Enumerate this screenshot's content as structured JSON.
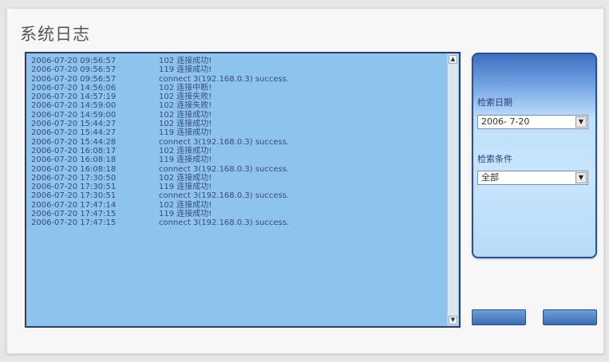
{
  "window": {
    "title": "系统日志"
  },
  "log": {
    "entries": [
      {
        "timestamp": "2006-07-20  09:56:57",
        "message": "102 连接成功!"
      },
      {
        "timestamp": "2006-07-20  09:56:57",
        "message": "119 连接成功!"
      },
      {
        "timestamp": "2006-07-20  09:56:57",
        "message": "connect 3(192.168.0.3) success."
      },
      {
        "timestamp": "2006-07-20  14:56:06",
        "message": "102 连接中断!"
      },
      {
        "timestamp": "2006-07-20  14:57:19",
        "message": "102 连接失败!"
      },
      {
        "timestamp": "2006-07-20  14:59:00",
        "message": "102 连接失败!"
      },
      {
        "timestamp": "2006-07-20  14:59:00",
        "message": "102 连接成功!"
      },
      {
        "timestamp": "2006-07-20  15:44:27",
        "message": "102 连接成功!"
      },
      {
        "timestamp": "2006-07-20  15:44:27",
        "message": "119 连接成功!"
      },
      {
        "timestamp": "2006-07-20  15:44:28",
        "message": "connect 3(192.168.0.3) success."
      },
      {
        "timestamp": "2006-07-20  16:08:17",
        "message": "102 连接成功!"
      },
      {
        "timestamp": "2006-07-20  16:08:18",
        "message": "119 连接成功!"
      },
      {
        "timestamp": "2006-07-20  16:08:18",
        "message": "connect 3(192.168.0.3) success."
      },
      {
        "timestamp": "2006-07-20  17:30:50",
        "message": "102 连接成功!"
      },
      {
        "timestamp": "2006-07-20  17:30:51",
        "message": "119 连接成功!"
      },
      {
        "timestamp": "2006-07-20  17:30:51",
        "message": "connect 3(192.168.0.3) success."
      },
      {
        "timestamp": "2006-07-20  17:47:14",
        "message": "102 连接成功!"
      },
      {
        "timestamp": "2006-07-20  17:47:15",
        "message": "119 连接成功!"
      },
      {
        "timestamp": "2006-07-20  17:47:15",
        "message": "connect 3(192.168.0.3) success."
      }
    ]
  },
  "filter": {
    "date_label": "检索日期",
    "date_value": "2006-  7-20",
    "condition_label": "检索条件",
    "condition_value": "全部"
  },
  "colors": {
    "log_background": "#8dc3ec",
    "log_text": "#384c7a",
    "panel_border": "#27509a",
    "button_fill": "#3e6cb3"
  },
  "icons": {
    "scroll_up": "triangle-up",
    "scroll_down": "triangle-down",
    "dropdown": "triangle-down"
  }
}
